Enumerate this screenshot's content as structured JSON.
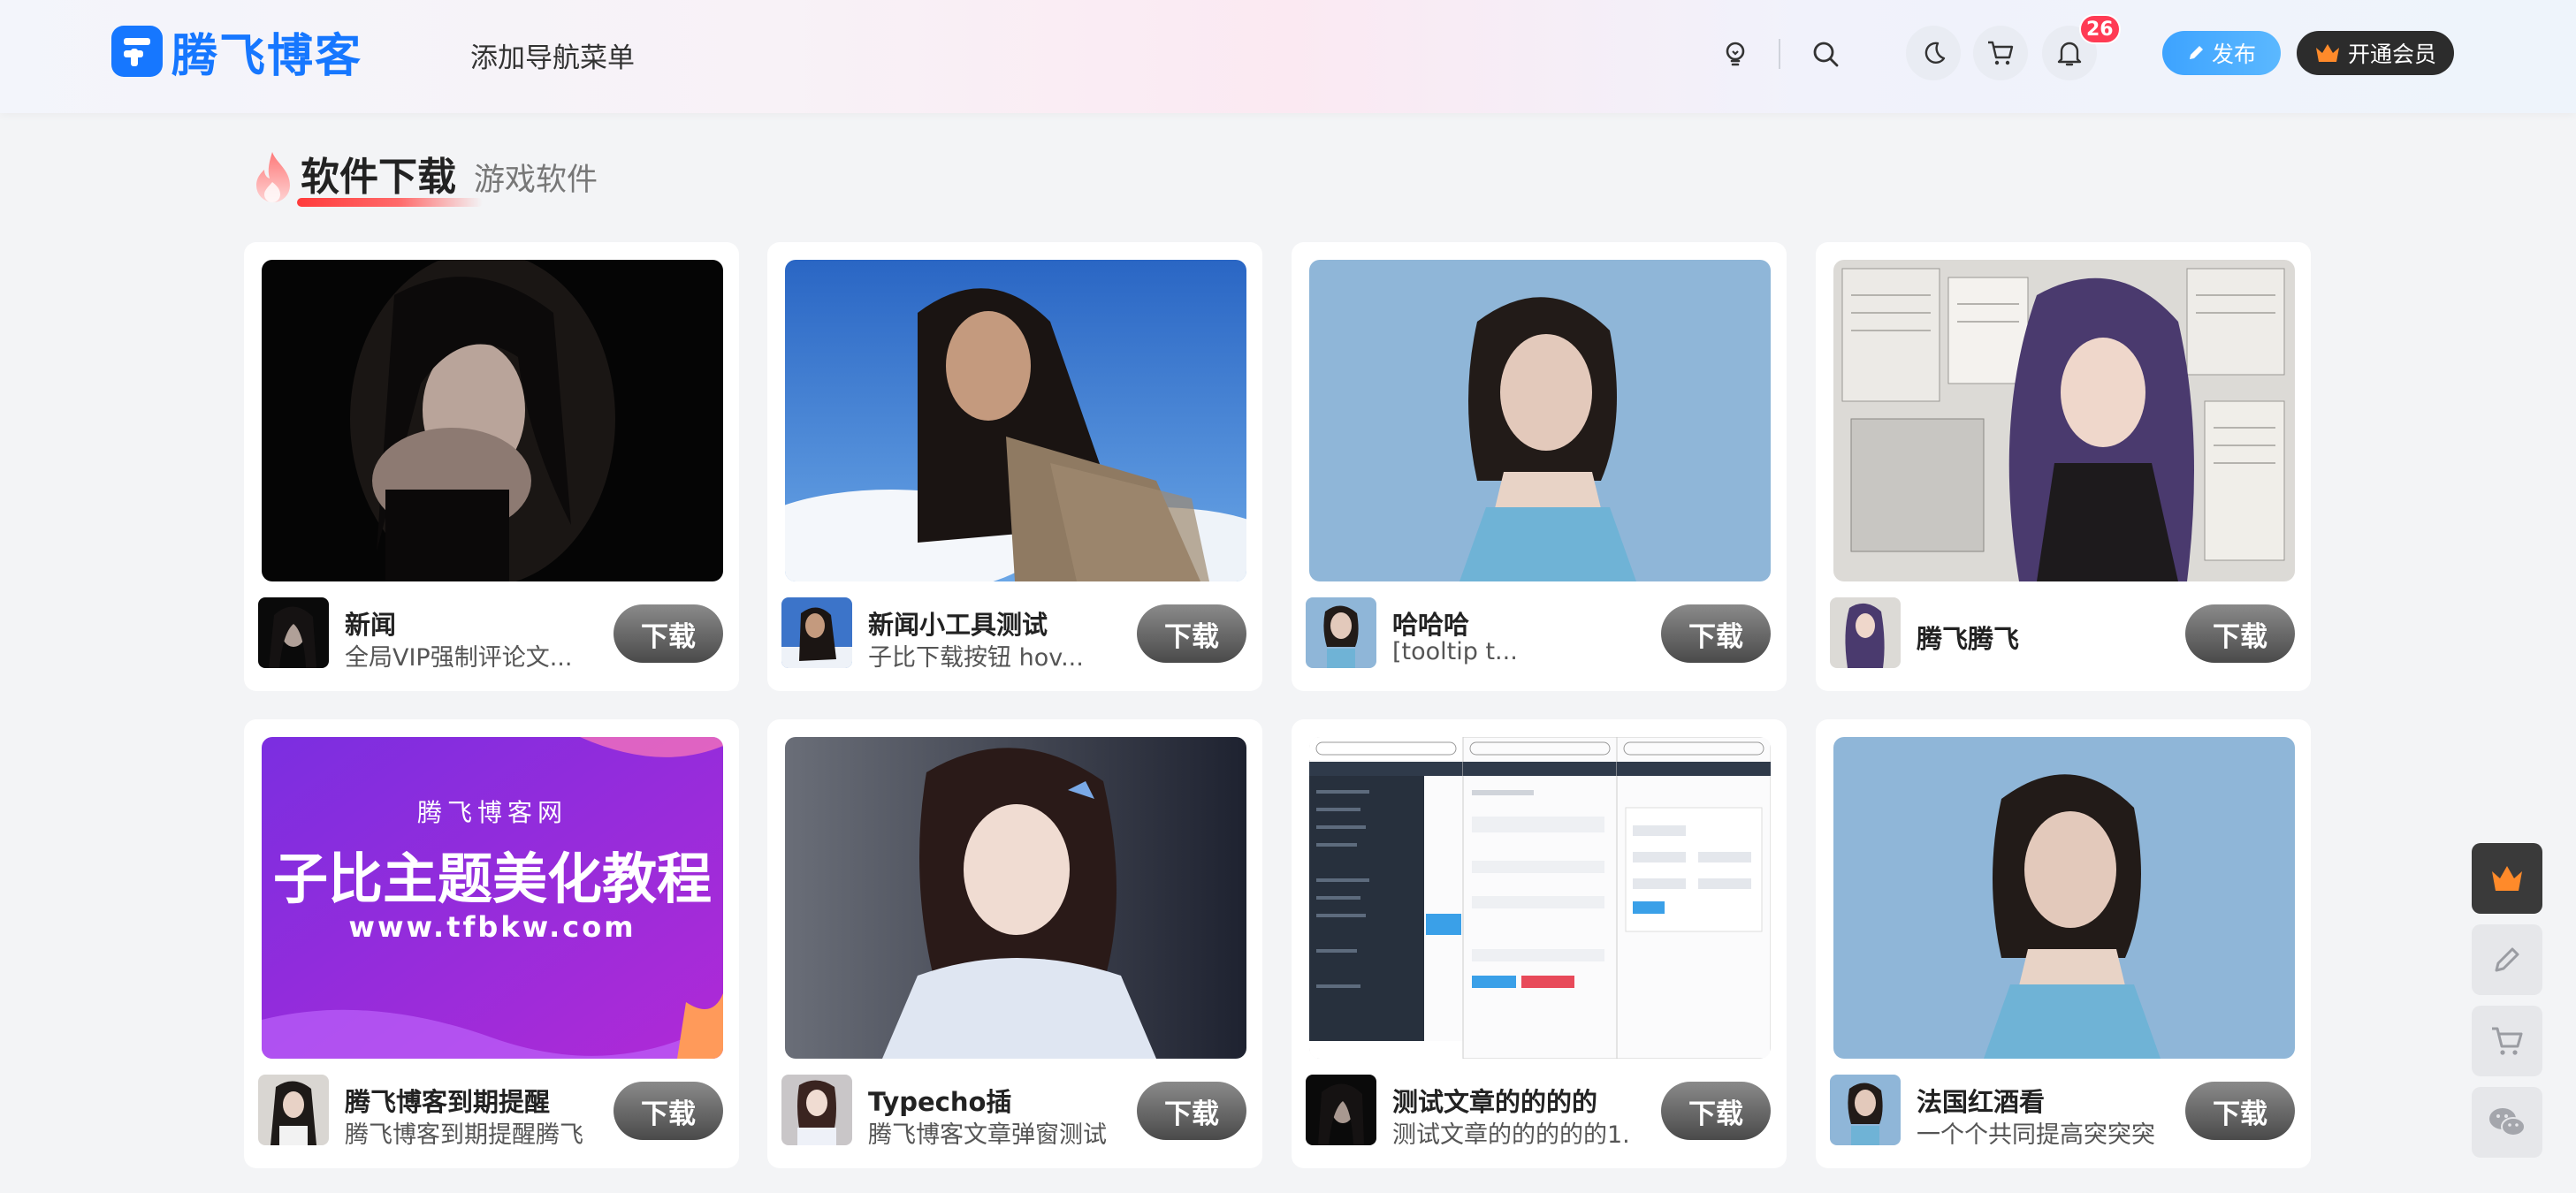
{
  "header": {
    "logo_text": "腾飞博客",
    "nav_add_label": "添加导航菜单",
    "notification_count": "26",
    "publish_label": "发布",
    "vip_label": "开通会员",
    "icons": [
      "lightbulb-icon",
      "search-icon",
      "moon-icon",
      "cart-icon",
      "bell-icon"
    ]
  },
  "section": {
    "title": "软件下载",
    "subtitle": "游戏软件"
  },
  "cards": [
    {
      "title": "新闻",
      "desc": "全局VIP强制评论文...",
      "button": "下载"
    },
    {
      "title": "新闻小工具测试",
      "desc": "子比下载按钮 hov...",
      "button": "下载"
    },
    {
      "title": "哈哈哈",
      "desc": "[tooltip t...",
      "button": "下载"
    },
    {
      "title": "腾飞腾飞",
      "desc": "",
      "button": "下载"
    },
    {
      "title": "腾飞博客到期提醒",
      "desc": "腾飞博客到期提醒腾飞...",
      "button": "下载"
    },
    {
      "title": "Typecho插",
      "desc": "腾飞博客文章弹窗测试...",
      "button": "下载"
    },
    {
      "title": "测试文章的的的的",
      "desc": "测试文章的的的的的1...",
      "button": "下载"
    },
    {
      "title": "法国红酒看",
      "desc": "一个个共同提高突突突",
      "button": "下载"
    }
  ],
  "banner": {
    "line1": "腾飞博客网",
    "line2": "子比主题美化教程",
    "line3": "www.tfbkw.com"
  },
  "sidebar": {
    "icons": [
      "crown-icon",
      "pencil-icon",
      "cart-icon",
      "wechat-icon"
    ]
  },
  "colors": {
    "brand": "#1677ff",
    "publish": "#3da3ff",
    "badge": "#ff3b54",
    "vip_crown": "#ff8a2a"
  }
}
